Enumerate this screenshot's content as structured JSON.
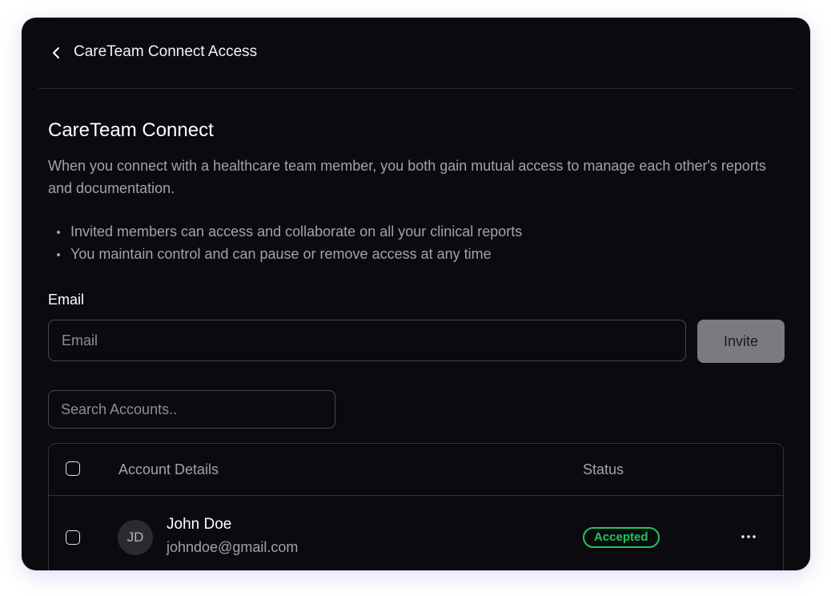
{
  "header": {
    "title": "CareTeam Connect Access",
    "back_icon": "chevron-left-icon"
  },
  "section": {
    "title": "CareTeam Connect",
    "description": "When you connect with a healthcare team member, you both gain mutual access to manage each other's reports and documentation.",
    "bullets": [
      "Invited members can access and collaborate on all your clinical reports",
      "You maintain control and can pause or remove access at any time"
    ]
  },
  "email": {
    "label": "Email",
    "placeholder": "Email",
    "value": ""
  },
  "invite": {
    "label": "Invite"
  },
  "search": {
    "placeholder": "Search Accounts..",
    "value": ""
  },
  "table": {
    "headers": {
      "account": "Account Details",
      "status": "Status"
    },
    "rows": [
      {
        "initials": "JD",
        "name": "John Doe",
        "email": "johndoe@gmail.com",
        "status": "Accepted",
        "menu_icon": "more-horizontal-icon"
      }
    ]
  },
  "colors": {
    "panel_bg": "#0b0a0f",
    "accepted": "#22c55e",
    "invite_bg": "#7b7a80"
  }
}
